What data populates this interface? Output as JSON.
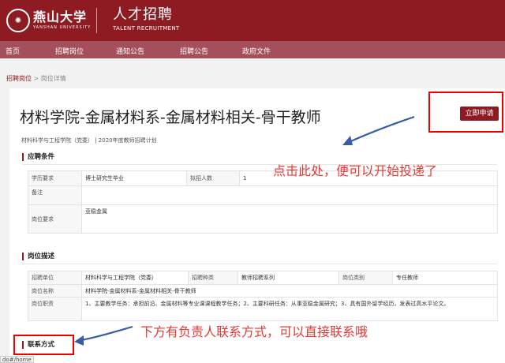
{
  "header": {
    "logo_cn": "燕山大学",
    "logo_en": "YANSHAN UNIVERSITY",
    "site_title": "人才招聘",
    "site_subtitle": "TALENT RECRUITMENT"
  },
  "nav": {
    "items": [
      {
        "label": "首页"
      },
      {
        "label": "招聘岗位"
      },
      {
        "label": "通知公告"
      },
      {
        "label": "招聘公告"
      },
      {
        "label": "政府文件"
      }
    ]
  },
  "breadcrumb": {
    "link": "招聘岗位",
    "sep": ">",
    "current": "岗位详情"
  },
  "job": {
    "title": "材料学院-金属材料系-金属材料相关-骨干教师",
    "apply_label": "立即申请",
    "meta": "材料科学与工程学院（党委）  |  2020年度教师招聘计划"
  },
  "requirements": {
    "title": "应聘条件",
    "edu_label": "学历要求",
    "edu_value": "博士研究生毕业",
    "count_label": "拟招人数",
    "count_value": "1",
    "remark_label": "备注",
    "remark_value": "",
    "req_label": "岗位要求",
    "req_value": "亚稳金属"
  },
  "description": {
    "title": "岗位描述",
    "unit_label": "招聘单位",
    "unit_value": "材料科学与工程学院（党委）",
    "type_label": "招聘种类",
    "type_value": "教师招聘系列",
    "cat_label": "岗位类别",
    "cat_value": "专任教师",
    "name_label": "岗位名称",
    "name_value": "材料学院-金属材料系-金属材料相关-骨干教师",
    "duty_label": "岗位职责",
    "duty_value": "1、主要教学任务：承担前沿、金属材料等专业课课程教学任务；2、主要科研任务：从事亚稳金属研究；3、具有国外留学经历，发表过高水平论文。"
  },
  "contact": {
    "title": "联系方式"
  },
  "annotations": {
    "apply_hint": "点击此处，便可以开始投递了",
    "contact_hint": "下方有负责人联系方式，可以直接联系哦"
  },
  "statusbar": {
    "url": "do#/home"
  },
  "colors": {
    "brand": "#8e1a22",
    "nav": "#a3505a",
    "annotation": "#e53935"
  }
}
